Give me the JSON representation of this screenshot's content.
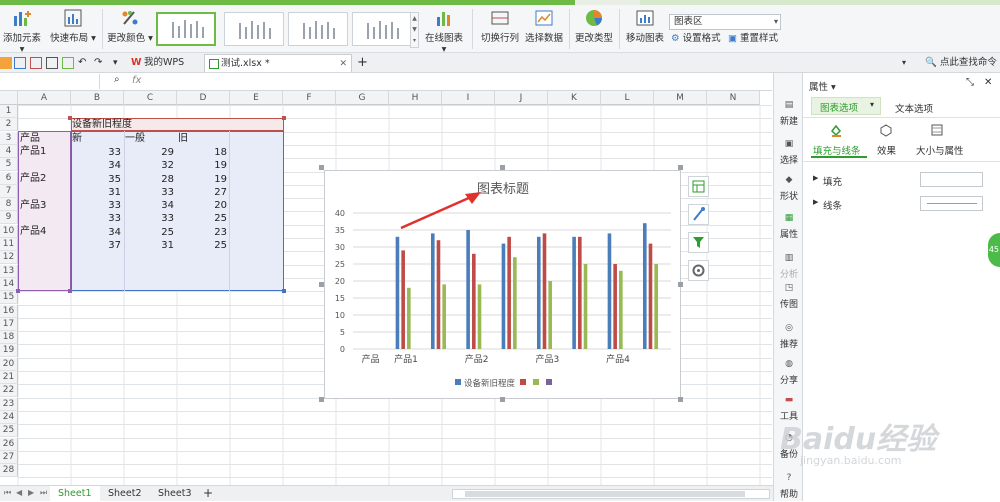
{
  "ribbon": {
    "buttons": [
      "添加元素",
      "快速布局",
      "更改颜色",
      "在线图表",
      "切换行列",
      "选择数据",
      "更改类型",
      "移动图表",
      "设置格式",
      "重置样式"
    ],
    "element_combo": "图表区"
  },
  "tabs": {
    "wps": "我的WPS",
    "file": "测试.xlsx *",
    "search_cmd": "点此查找命令"
  },
  "formula": {
    "fx": "fx"
  },
  "columns": [
    "A",
    "B",
    "C",
    "D",
    "E",
    "F",
    "G",
    "H",
    "I",
    "J",
    "K",
    "L",
    "M",
    "N"
  ],
  "rows": [
    "1",
    "2",
    "3",
    "4",
    "5",
    "6",
    "7",
    "8",
    "9",
    "10",
    "11",
    "12",
    "13",
    "14",
    "15",
    "16",
    "17",
    "18",
    "19",
    "20",
    "21",
    "22",
    "23",
    "24",
    "25",
    "26",
    "27",
    "28"
  ],
  "sheet": {
    "title": "设备新旧程度",
    "header": [
      "产品",
      "新",
      "一般",
      "旧"
    ],
    "products": [
      "产品1",
      "产品2",
      "产品3",
      "产品4"
    ],
    "data": [
      [
        33,
        29,
        18
      ],
      [
        34,
        32,
        19
      ],
      [
        35,
        28,
        19
      ],
      [
        31,
        33,
        27
      ],
      [
        33,
        34,
        20
      ],
      [
        33,
        33,
        25
      ],
      [
        34,
        25,
        23
      ],
      [
        37,
        31,
        25
      ]
    ]
  },
  "chart_data": {
    "type": "bar",
    "title": "图表标题",
    "categories": [
      "产品",
      "产品1",
      "",
      "产品2",
      "",
      "产品3",
      "",
      "产品4",
      ""
    ],
    "series": [
      {
        "name": "设备新旧程度",
        "values": [
          null,
          33,
          34,
          35,
          31,
          33,
          33,
          34,
          37
        ]
      },
      {
        "name": "",
        "values": [
          null,
          29,
          32,
          28,
          33,
          34,
          33,
          25,
          31
        ]
      },
      {
        "name": "",
        "values": [
          null,
          18,
          19,
          19,
          27,
          20,
          25,
          23,
          25
        ]
      },
      {
        "name": "",
        "values": [
          null,
          null,
          null,
          null,
          null,
          null,
          null,
          null,
          null
        ]
      }
    ],
    "ylim": [
      0,
      40
    ],
    "yticks": [
      0,
      5,
      10,
      15,
      20,
      25,
      30,
      35,
      40
    ],
    "grid": true,
    "legend": "bottom",
    "colors": [
      "#4a7ebb",
      "#be4b48",
      "#98b954",
      "#7d60a0"
    ]
  },
  "panel": {
    "title": "属性",
    "tab_chart": "图表选项",
    "tab_text": "文本选项",
    "sub_fill": "填充与线条",
    "sub_effect": "效果",
    "sub_size": "大小与属性",
    "fill": "填充",
    "line": "线条"
  },
  "vtools": [
    "新建",
    "选择",
    "形状",
    "属性",
    "分析",
    "传图",
    "推荐",
    "分享",
    "工具",
    "备份",
    "帮助"
  ],
  "sheets": [
    "Sheet1",
    "Sheet2",
    "Sheet3"
  ],
  "watermark": "Baidu经验",
  "watermark_url": "jingyan.baidu.com",
  "edge_badge": "45",
  "colors": {
    "accent": "#6dbb45",
    "selection": "#4472c4",
    "title_border": "#c0504d"
  }
}
